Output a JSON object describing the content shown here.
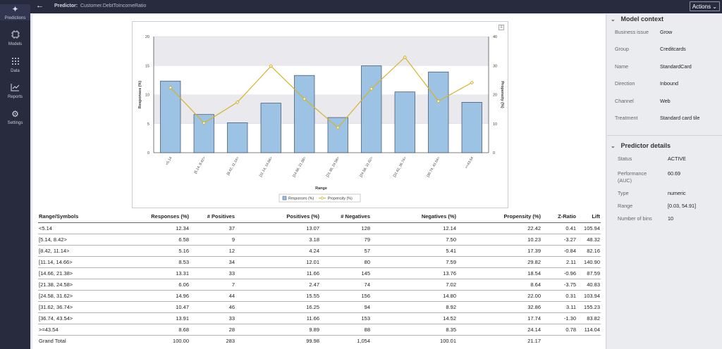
{
  "nav": {
    "items": [
      {
        "label": "Predictions",
        "icon": "sparkle-icon"
      },
      {
        "label": "Models",
        "icon": "chip-icon"
      },
      {
        "label": "Data",
        "icon": "grid-icon"
      },
      {
        "label": "Reports",
        "icon": "line-chart-icon"
      },
      {
        "label": "Settings",
        "icon": "gear-icon"
      }
    ]
  },
  "header": {
    "title_prefix": "Predictor:",
    "title_value": "Customer.DebtToIncomeRatio",
    "actions_label": "Actions"
  },
  "chart_data": {
    "type": "bar",
    "categories": [
      "<5.14",
      "[5.14, 8.42>",
      "[8.42, 11.14>",
      "[11.14, 14.66>",
      "[14.66, 21.38>",
      "[21.38, 24.58>",
      "[24.58, 31.62>",
      "[31.62, 36.74>",
      "[36.74, 43.54>",
      ">=43.54"
    ],
    "series": [
      {
        "name": "Responses (%)",
        "type": "bar",
        "axis": "left",
        "color": "#9cc3e4",
        "values": [
          12.34,
          6.58,
          5.16,
          8.53,
          13.31,
          6.06,
          14.96,
          10.47,
          13.91,
          8.68
        ]
      },
      {
        "name": "Propensity (%)",
        "type": "line",
        "axis": "right",
        "color": "#d4b42b",
        "values": [
          22.42,
          10.23,
          17.39,
          29.82,
          18.54,
          8.64,
          22.0,
          32.86,
          17.74,
          24.14
        ]
      }
    ],
    "xlabel": "Range",
    "ylabel": "Responses (%)",
    "y2label": "Propensity (%)",
    "ylim": [
      0,
      20
    ],
    "y2lim": [
      0,
      40
    ],
    "yticks": [
      "0",
      "5",
      "10",
      "15",
      "20"
    ],
    "y2ticks": [
      "0",
      "10",
      "20",
      "30",
      "40"
    ],
    "legend": "bottom-center",
    "grid": true
  },
  "table": {
    "headers": [
      "Range/Symbols",
      "Responses (%)",
      "# Positives",
      "Positives (%)",
      "# Negatives",
      "Negatives (%)",
      "Propensity (%)",
      "Z-Ratio",
      "Lift"
    ],
    "rows": [
      [
        "<5.14",
        "12.34",
        "37",
        "13.07",
        "128",
        "12.14",
        "22.42",
        "0.41",
        "105.94"
      ],
      [
        "[5.14, 8.42>",
        "6.58",
        "9",
        "3.18",
        "79",
        "7.50",
        "10.23",
        "-3.27",
        "48.32"
      ],
      [
        "[8.42, 11.14>",
        "5.16",
        "12",
        "4.24",
        "57",
        "5.41",
        "17.39",
        "-0.84",
        "82.16"
      ],
      [
        "[11.14, 14.66>",
        "8.53",
        "34",
        "12.01",
        "80",
        "7.59",
        "29.82",
        "2.11",
        "140.90"
      ],
      [
        "[14.66, 21.38>",
        "13.31",
        "33",
        "11.66",
        "145",
        "13.76",
        "18.54",
        "-0.96",
        "87.59"
      ],
      [
        "[21.38, 24.58>",
        "6.06",
        "7",
        "2.47",
        "74",
        "7.02",
        "8.64",
        "-3.75",
        "40.83"
      ],
      [
        "[24.58, 31.62>",
        "14.96",
        "44",
        "15.55",
        "156",
        "14.80",
        "22.00",
        "0.31",
        "103.94"
      ],
      [
        "[31.62, 36.74>",
        "10.47",
        "46",
        "16.25",
        "94",
        "8.92",
        "32.86",
        "3.11",
        "155.23"
      ],
      [
        "[36.74, 43.54>",
        "13.91",
        "33",
        "11.66",
        "153",
        "14.52",
        "17.74",
        "-1.30",
        "83.82"
      ],
      [
        ">=43.54",
        "8.68",
        "28",
        "9.89",
        "88",
        "8.35",
        "24.14",
        "0.78",
        "114.04"
      ]
    ],
    "total": [
      "Grand Total",
      "100.00",
      "283",
      "99.98",
      "1,054",
      "100.01",
      "21.17",
      "",
      ""
    ]
  },
  "model_context": {
    "title": "Model context",
    "items": [
      {
        "k": "Business issue",
        "v": "Grow"
      },
      {
        "k": "Group",
        "v": "Creditcards"
      },
      {
        "k": "Name",
        "v": "StandardCard"
      },
      {
        "k": "Direction",
        "v": "Inbound"
      },
      {
        "k": "Channel",
        "v": "Web"
      },
      {
        "k": "Treatment",
        "v": "Standard card tile"
      }
    ]
  },
  "predictor_details": {
    "title": "Predictor details",
    "items": [
      {
        "k": "Status",
        "v": "ACTIVE"
      },
      {
        "k": "Performance (AUC)",
        "v": "60.69"
      },
      {
        "k": "Type",
        "v": "numeric"
      },
      {
        "k": "Range",
        "v": "[0.03, 54.91]"
      },
      {
        "k": "Number of bins",
        "v": "10"
      }
    ]
  }
}
